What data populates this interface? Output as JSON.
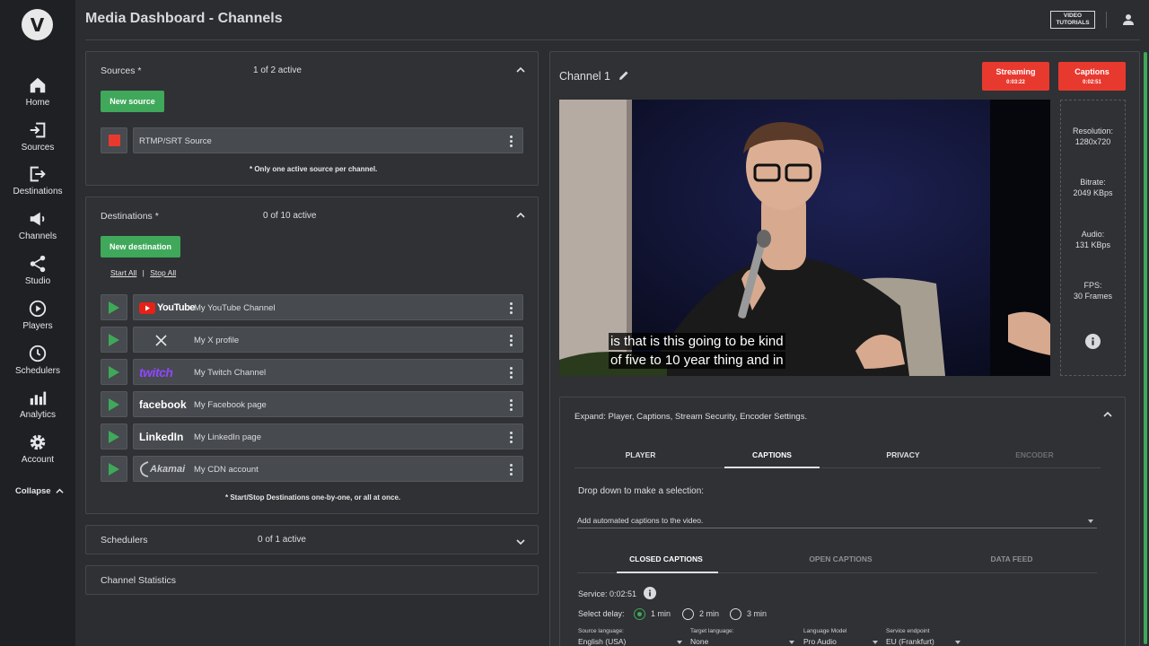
{
  "sidebar": {
    "logo": "V",
    "items": [
      {
        "label": "Home",
        "icon": "home-icon"
      },
      {
        "label": "Sources",
        "icon": "sign-in-icon"
      },
      {
        "label": "Destinations",
        "icon": "sign-out-icon"
      },
      {
        "label": "Channels",
        "icon": "megaphone-icon"
      },
      {
        "label": "Studio",
        "icon": "share-icon"
      },
      {
        "label": "Players",
        "icon": "play-circle-icon"
      },
      {
        "label": "Schedulers",
        "icon": "clock-icon"
      },
      {
        "label": "Analytics",
        "icon": "bar-chart-icon"
      },
      {
        "label": "Account",
        "icon": "gear-icon"
      }
    ],
    "collapse_label": "Collapse"
  },
  "header": {
    "title": "Media Dashboard - Channels",
    "video_tutorials": [
      "VIDEO",
      "TUTORIALS"
    ]
  },
  "sources": {
    "title": "Sources *",
    "count": "1 of 2 active",
    "new_button": "New source",
    "items": [
      {
        "label": "RTMP/SRT Source"
      }
    ],
    "note": "* Only one active source per channel."
  },
  "destinations": {
    "title": "Destinations *",
    "count": "0 of 10 active",
    "new_button": "New destination",
    "start_all": "Start All",
    "separator": "|",
    "stop_all": "Stop All",
    "items": [
      {
        "logo": "YouTube",
        "label": "My YouTube Channel"
      },
      {
        "logo": "X",
        "label": "My X profile"
      },
      {
        "logo": "twitch",
        "label": "My Twitch Channel"
      },
      {
        "logo": "facebook",
        "label": "My Facebook page"
      },
      {
        "logo": "LinkedIn",
        "label": "My LinkedIn page"
      },
      {
        "logo": "Akamai",
        "label": "My CDN account"
      }
    ],
    "note": "* Start/Stop Destinations one-by-one, or all at once."
  },
  "schedulers": {
    "title": "Schedulers",
    "count": "0 of 1 active"
  },
  "channel_stats": {
    "title": "Channel Statistics"
  },
  "channel": {
    "title": "Channel 1",
    "streaming": {
      "label": "Streaming",
      "time": "0:03:22"
    },
    "captions": {
      "label": "Captions",
      "time": "0:02:51"
    },
    "caption_lines": [
      "is that is this going to be kind",
      "of five to 10 year thing and in"
    ],
    "stats": [
      {
        "label": "Resolution:",
        "value": "1280x720"
      },
      {
        "label": "Bitrate:",
        "value": "2049 KBps"
      },
      {
        "label": "Audio:",
        "value": "131 KBps"
      },
      {
        "label": "FPS:",
        "value": "30 Frames"
      }
    ]
  },
  "settings": {
    "expand_label": "Expand: Player, Captions, Stream Security, Encoder Settings.",
    "tabs": [
      "PLAYER",
      "CAPTIONS",
      "PRIVACY",
      "ENCODER"
    ],
    "active_tab": "CAPTIONS",
    "dropdown_hint": "Drop down to make a selection:",
    "dropdown_value": "Add automated captions to the video.",
    "subtabs": [
      "CLOSED CAPTIONS",
      "OPEN CAPTIONS",
      "DATA FEED"
    ],
    "service": "Service: 0:02:51",
    "delay_label": "Select delay:",
    "delays": [
      "1 min",
      "2 min",
      "3 min"
    ],
    "selected_delay": "1 min",
    "fields": [
      {
        "label": "Source language:",
        "value": "English (USA)"
      },
      {
        "label": "Target language:",
        "value": "None"
      },
      {
        "label": "Language Model",
        "value": "Pro Audio"
      },
      {
        "label": "Service endpoint",
        "value": "EU (Frankfurt)"
      }
    ]
  },
  "colors": {
    "accent_green": "#3fa85a",
    "live_red": "#e8392f",
    "background": "#2b2d30"
  }
}
